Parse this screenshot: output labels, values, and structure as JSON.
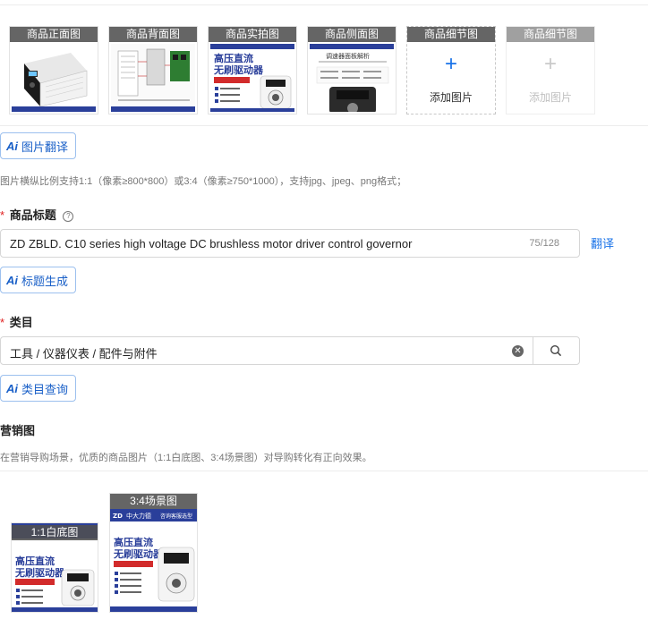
{
  "images": {
    "slots": [
      {
        "caption": "商品正面图",
        "type": "photo"
      },
      {
        "caption": "商品背面图",
        "type": "photo"
      },
      {
        "caption": "商品实拍图",
        "type": "photo"
      },
      {
        "caption": "商品侧面图",
        "type": "photo"
      },
      {
        "caption": "商品细节图",
        "type": "add",
        "add_label": "添加图片"
      },
      {
        "caption": "商品细节图",
        "type": "add_disabled",
        "add_label": "添加图片"
      }
    ],
    "ai_button": "图片翻译",
    "hint": "图片横纵比例支持1:1（像素≥800*800）或3:4（像素≥750*1000），支持jpg、jpeg、png格式；"
  },
  "art_text": {
    "brand": "ZD",
    "title_line1": "高压直流",
    "title_line2": "无刷驱动器",
    "sub_tag": "中压电机上不推荐",
    "side_banner": "调速器面板解析",
    "side_head": "中大力德",
    "side_head_sub": "咨询客服选型"
  },
  "ai_icon": "Ai",
  "title_field": {
    "label": "商品标题",
    "required_mark": "*",
    "help_icon": "?",
    "value": "ZD ZBLD. C10 series high voltage DC brushless motor driver control governor",
    "count": "75/128",
    "translate": "翻译",
    "ai_button": "标题生成"
  },
  "category_field": {
    "label": "类目",
    "required_mark": "*",
    "value": "工具 / 仪器仪表 / 配件与附件",
    "ai_button": "类目查询"
  },
  "marketing": {
    "label": "营销图",
    "hint": "在营销导购场景，优质的商品图片（1:1白底图、3:4场景图）对导购转化有正向效果。",
    "items": [
      {
        "caption": "1:1白底图"
      },
      {
        "caption": "3:4场景图"
      }
    ]
  },
  "colors": {
    "accent": "#1a73e8",
    "required": "#e02020",
    "product_blue": "#2a3f9a",
    "product_red": "#d22b2b"
  }
}
